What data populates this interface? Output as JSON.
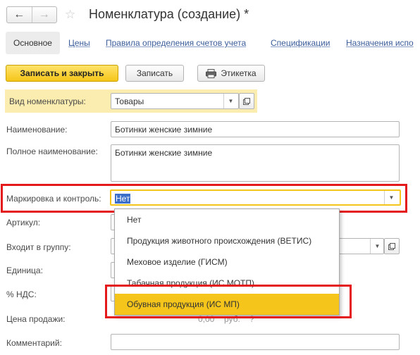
{
  "window": {
    "title": "Номенклатура (создание) *"
  },
  "nav": {
    "back_icon": "←",
    "forward_icon": "→",
    "favorite_icon": "☆"
  },
  "tabs": [
    {
      "label": "Основное",
      "active": true
    },
    {
      "label": "Цены"
    },
    {
      "label": "Правила определения счетов учета"
    },
    {
      "label": "Спецификации"
    },
    {
      "label": "Назначения испо"
    }
  ],
  "toolbar": {
    "save_close_label": "Записать и закрыть",
    "save_label": "Записать",
    "label_print_label": "Этикетка"
  },
  "form": {
    "vid": {
      "label": "Вид номенклатуры:",
      "value": "Товары"
    },
    "name": {
      "label": "Наименование:",
      "value": "Ботинки женские зимние"
    },
    "full_name": {
      "label": "Полное наименование:",
      "value": "Ботинки женские зимние"
    },
    "marking": {
      "label": "Маркировка и контроль:",
      "value": "Нет"
    },
    "article": {
      "label": "Артикул:"
    },
    "group": {
      "label": "Входит в группу:"
    },
    "unit": {
      "label": "Единица:"
    },
    "vat": {
      "label": "% НДС:"
    },
    "price": {
      "label": "Цена продажи:",
      "value": "0,00",
      "currency": "руб.",
      "help": "?"
    },
    "comment": {
      "label": "Комментарий:"
    }
  },
  "dropdown": {
    "options": [
      "Нет",
      "Продукция животного происхождения (ВЕТИС)",
      "Меховое изделие (ГИСМ)",
      "Табачная продукция (ИС МОТП)",
      "Обувная продукция (ИС МП)"
    ],
    "highlighted_index": 4
  },
  "colors": {
    "accent_yellow": "#f5c51b",
    "band_yellow": "#fbedaf",
    "annotation_red": "#e3191c",
    "link_blue": "#3b5d9a"
  }
}
